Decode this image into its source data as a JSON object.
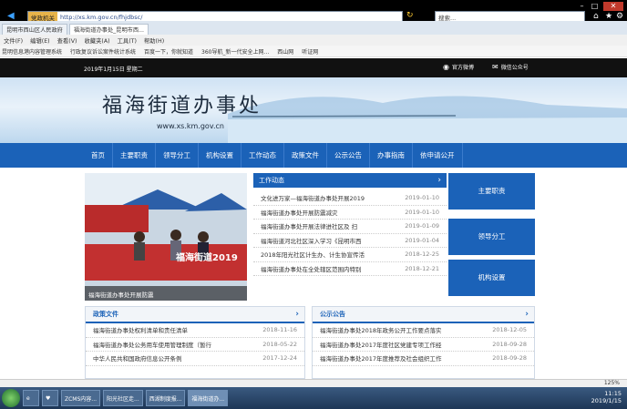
{
  "browser": {
    "url_ident": "党政机关",
    "url": "http://xs.km.gov.cn/fhjdbsc/",
    "search_placeholder": "搜索...",
    "tabs": [
      {
        "label": "昆明市西山区人民政府"
      },
      {
        "label": "福海街道办事处_昆明市西..."
      }
    ],
    "menu": [
      "文件(F)",
      "编辑(E)",
      "查看(V)",
      "收藏夹(A)",
      "工具(T)",
      "帮助(H)"
    ],
    "favorites": [
      "昆明信息港内容管理系统",
      "行政复议诉讼案件统计系统",
      "百度一下，你就知道",
      "360导航_新一代安全上网...",
      "西山网",
      "听证网"
    ],
    "zoom": "125%"
  },
  "site": {
    "date": "2019年1月15日 星期二",
    "weibo": "官方微博",
    "wechat": "微信公众号",
    "title": "福海街道办事处",
    "url": "www.xs.km.gov.cn",
    "nav": [
      "首页",
      "主要职责",
      "领导分工",
      "机构设置",
      "工作动态",
      "政策文件",
      "公示公告",
      "办事指南",
      "依申请公开"
    ],
    "photo_caption": "福海街道办事处开展防震",
    "photo_banner": "福海街道2019",
    "work": {
      "title": "工作动态",
      "items": [
        {
          "text": "文化进万家—福海街道办事处开展2019",
          "date": "2019-01-10"
        },
        {
          "text": "福海街道办事处开展防震减灾",
          "date": "2019-01-10"
        },
        {
          "text": "福海街道办事处开展法律进社区及 扫",
          "date": "2019-01-09"
        },
        {
          "text": "福海街道河北社区深入学习《昆明市西",
          "date": "2019-01-04"
        },
        {
          "text": "2018年阳光社区计生办、计生协宣传活",
          "date": "2018-12-25"
        },
        {
          "text": "福海街道办事处在全处辖区范围内特别",
          "date": "2018-12-21"
        }
      ]
    },
    "side_buttons": [
      "主要职责",
      "领导分工",
      "机构设置"
    ],
    "policy": {
      "title": "政策文件",
      "items": [
        {
          "text": "福海街道办事处权利清单和责任清单",
          "date": "2018-11-16"
        },
        {
          "text": "福海街道办事处公务用车使用管理制度（暂行",
          "date": "2018-05-22"
        },
        {
          "text": "中华人民共和国政府信息公开条例",
          "date": "2017-12-24"
        }
      ]
    },
    "notice": {
      "title": "公示公告",
      "items": [
        {
          "text": "福海街道办事处2018年政务公开工作要点落实",
          "date": "2018-12-05"
        },
        {
          "text": "福海街道办事处2017年度社区党建专项工作经",
          "date": "2018-09-28"
        },
        {
          "text": "福海街道办事处2017年度推荐及社会组织工作",
          "date": "2018-09-28"
        }
      ]
    }
  },
  "taskbar": {
    "apps": [
      "ZCMS内容...",
      "阳光社区走...",
      "西湖制度报...",
      "福海街道办..."
    ],
    "time": "11:15",
    "date": "2019/1/15"
  }
}
